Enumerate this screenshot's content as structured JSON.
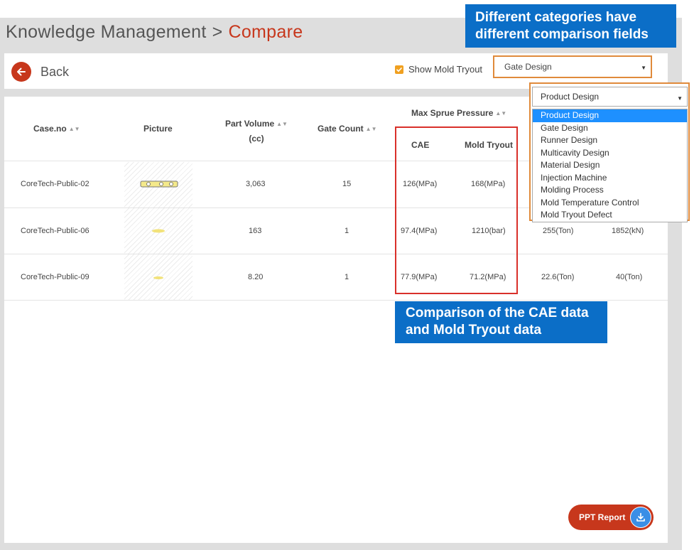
{
  "breadcrumb": {
    "parent": "Knowledge Management",
    "separator": ">",
    "current": "Compare"
  },
  "toolbar": {
    "back_label": "Back",
    "show_mold_tryout_label": "Show Mold Tryout",
    "show_mold_tryout_checked": true,
    "category_select_value": "Gate Design"
  },
  "table": {
    "headers": {
      "case_no": "Case.no",
      "picture": "Picture",
      "part_volume": "Part Volume",
      "part_volume_unit": "(cc)",
      "gate_count": "Gate Count",
      "max_sprue_pressure": "Max Sprue Pressure",
      "cae": "CAE",
      "mold_tryout": "Mold Tryout"
    },
    "rows": [
      {
        "case_no": "CoreTech-Public-02",
        "part_volume": "3,063",
        "gate_count": "15",
        "cae": "126(MPa)",
        "mold_tryout": "168(MPa)",
        "extra1": "",
        "extra2": ""
      },
      {
        "case_no": "CoreTech-Public-06",
        "part_volume": "163",
        "gate_count": "1",
        "cae": "97.4(MPa)",
        "mold_tryout": "1210(bar)",
        "extra1": "255(Ton)",
        "extra2": "1852(kN)"
      },
      {
        "case_no": "CoreTech-Public-09",
        "part_volume": "8.20",
        "gate_count": "1",
        "cae": "77.9(MPa)",
        "mold_tryout": "71.2(MPa)",
        "extra1": "22.6(Ton)",
        "extra2": "40(Ton)"
      }
    ]
  },
  "dropdown": {
    "selected_value": "Product Design",
    "options": [
      "Product Design",
      "Gate Design",
      "Runner Design",
      "Multicavity Design",
      "Material Design",
      "Injection Machine",
      "Molding Process",
      "Mold Temperature Control",
      "Mold Tryout Defect"
    ],
    "highlighted_index": 0
  },
  "callouts": {
    "top": [
      "Different categories have",
      "different comparison fields"
    ],
    "middle": [
      "Comparison of the CAE data",
      "and Mold Tryout data"
    ]
  },
  "ppt_report_label": "PPT Report",
  "colors": {
    "accent_red": "#c7371c",
    "callout_blue": "#0b6ec7",
    "highlight_orange": "#e08a3b",
    "checkbox_orange": "#f0a020"
  },
  "icons": {
    "back": "arrow-left-icon",
    "sort": "sort-icon",
    "download": "download-icon",
    "check": "check-icon"
  }
}
